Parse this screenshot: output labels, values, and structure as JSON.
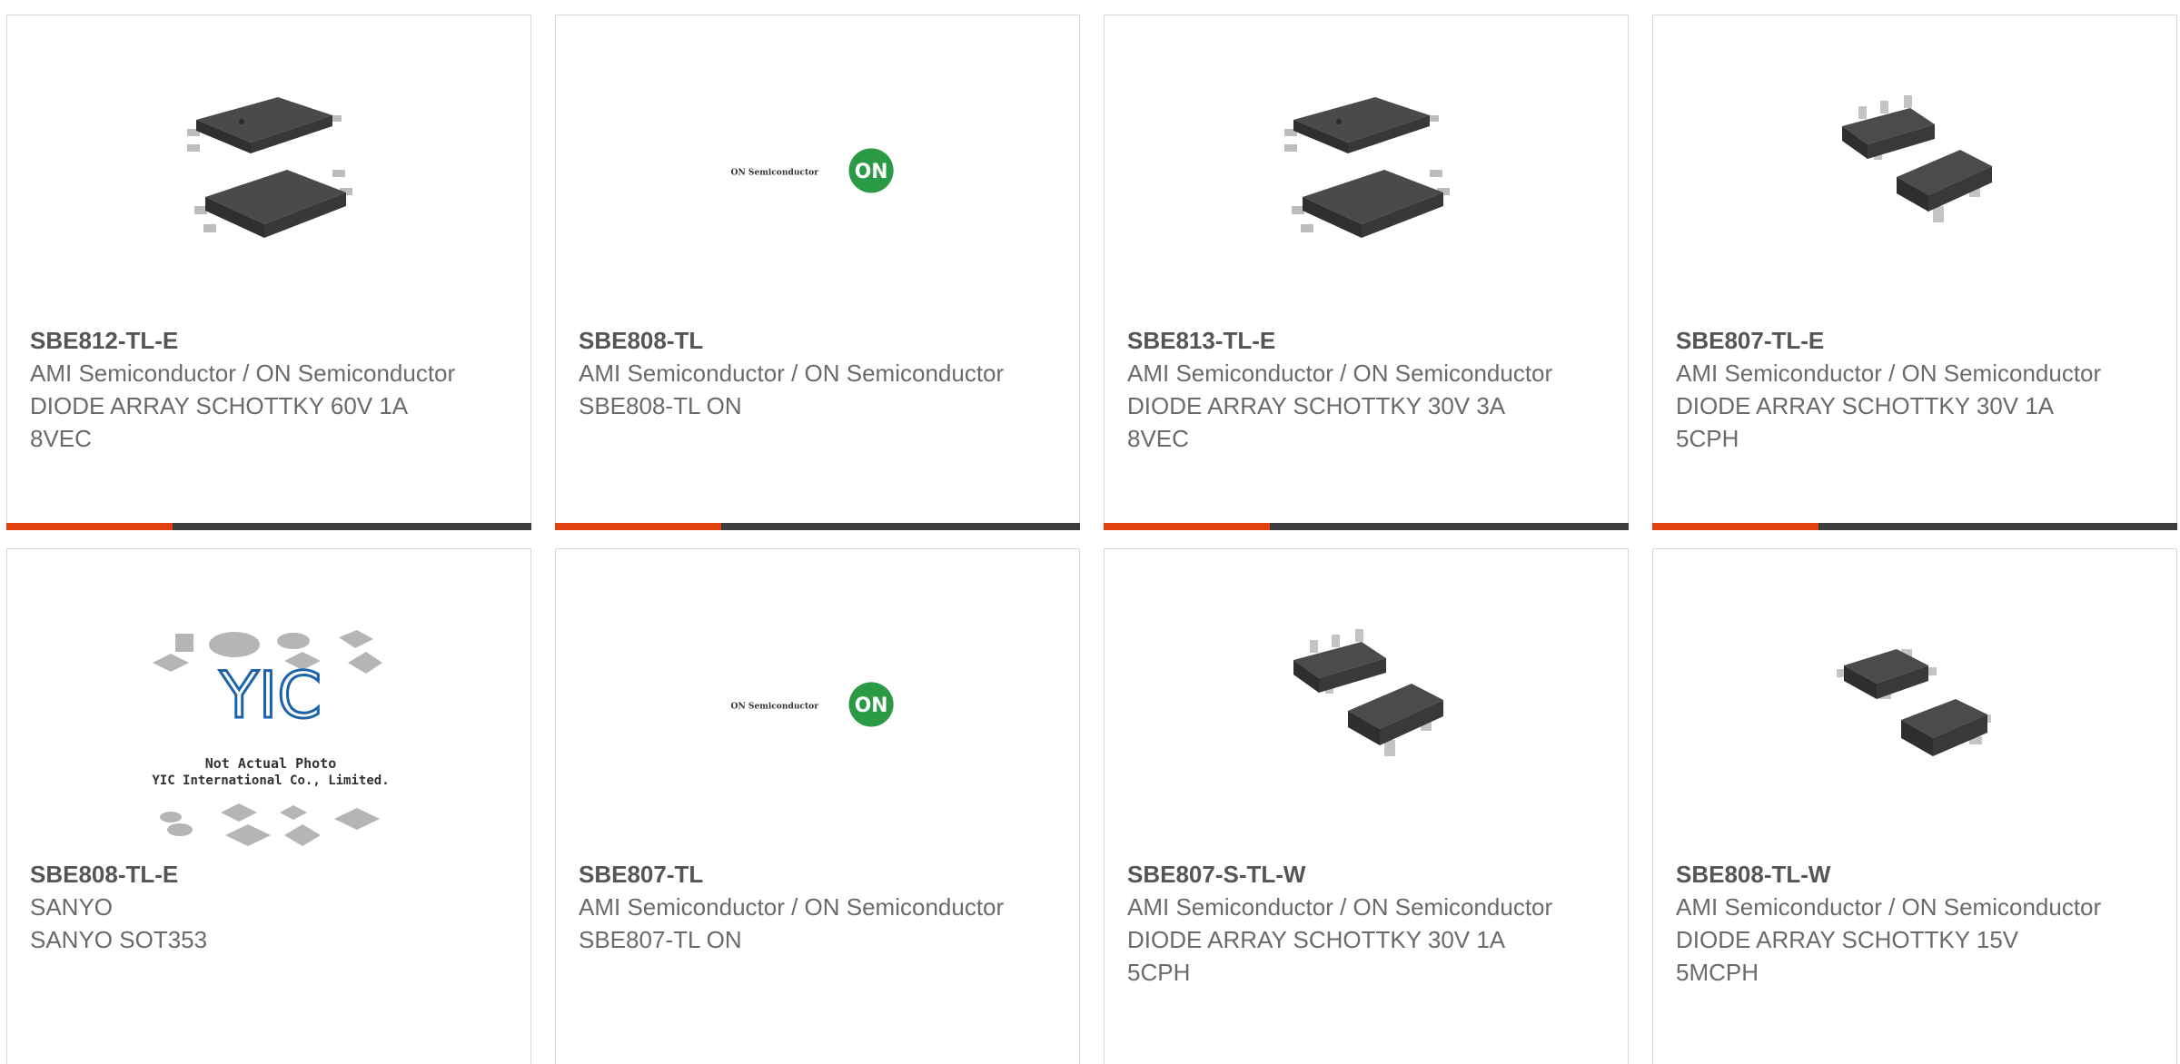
{
  "colors": {
    "accent": "#e1400f",
    "bar_dark": "#3d3d3d",
    "text": "#6a6a6a",
    "border": "#d8d8d8"
  },
  "products": [
    {
      "part_number": "SBE812-TL-E",
      "manufacturer": "AMI Semiconductor / ON Semiconductor",
      "description": "DIODE ARRAY SCHOTTKY 60V 1A 8VEC",
      "image": "8-pin-chip-package",
      "bar": true
    },
    {
      "part_number": "SBE808-TL",
      "manufacturer": "AMI Semiconductor / ON Semiconductor",
      "description": "SBE808-TL ON",
      "image": "on-semiconductor-logo",
      "logo_text": "ON Semiconductor",
      "logo_badge": "ON",
      "bar": true
    },
    {
      "part_number": "SBE813-TL-E",
      "manufacturer": "AMI Semiconductor / ON Semiconductor",
      "description": "DIODE ARRAY SCHOTTKY 30V 3A 8VEC",
      "image": "8-pin-chip-package",
      "bar": true
    },
    {
      "part_number": "SBE807-TL-E",
      "manufacturer": "AMI Semiconductor / ON Semiconductor",
      "description": "DIODE ARRAY SCHOTTKY 30V 1A 5CPH",
      "image": "5-pin-chip-package",
      "bar": true
    },
    {
      "part_number": "SBE808-TL-E",
      "manufacturer": "SANYO",
      "description": "SANYO SOT353",
      "image": "yic-placeholder",
      "placeholder_line1": "Not Actual Photo",
      "placeholder_line2": "YIC International Co., Limited.",
      "placeholder_logo": "YIC",
      "bar": false
    },
    {
      "part_number": "SBE807-TL",
      "manufacturer": "AMI Semiconductor / ON Semiconductor",
      "description": "SBE807-TL ON",
      "image": "on-semiconductor-logo",
      "logo_text": "ON Semiconductor",
      "logo_badge": "ON",
      "bar": false
    },
    {
      "part_number": "SBE807-S-TL-W",
      "manufacturer": "AMI Semiconductor / ON Semiconductor",
      "description": "DIODE ARRAY SCHOTTKY 30V 1A 5CPH",
      "image": "5-pin-chip-package",
      "bar": false
    },
    {
      "part_number": "SBE808-TL-W",
      "manufacturer": "AMI Semiconductor / ON Semiconductor",
      "description": "DIODE ARRAY SCHOTTKY 15V 5MCPH",
      "image": "5-pin-small-chip-package",
      "bar": false
    }
  ]
}
